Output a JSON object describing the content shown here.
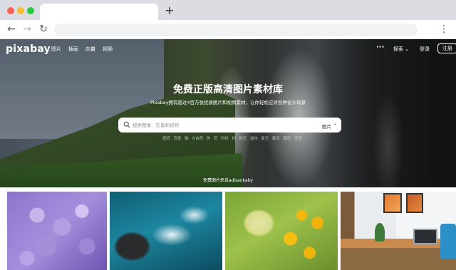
{
  "browser": {
    "new_tab_label": "+",
    "back_glyph": "←",
    "forward_glyph": "→",
    "reload_glyph": "↻",
    "menu_glyph": "⋮"
  },
  "header": {
    "logo": "pixabay",
    "nav": [
      "图片",
      "插画",
      "向量",
      "视频"
    ],
    "more": "···",
    "explore": "探索 ⌄",
    "login": "登录",
    "join": "注册"
  },
  "hero": {
    "title": "免费正版高清图片素材库",
    "subtitle": "Pixabay拥有超过4百万张优质图片和视频素材，让你轻松应对各种设计场景",
    "search": {
      "placeholder": "搜索图像、矢量和视频",
      "type": "图片",
      "chevron": "⌄"
    },
    "tags": [
      "壁纸",
      "背景",
      "猫",
      "大自然",
      "狗",
      "花",
      "科技",
      "树",
      "秋天",
      "城市",
      "夏天",
      "春天",
      "蓝色",
      "天空",
      "风景",
      "水"
    ],
    "credit": "免费图片来自adisankaby"
  },
  "colors": {
    "join_border": "#ffffff",
    "chrome": "#dcdde3"
  }
}
